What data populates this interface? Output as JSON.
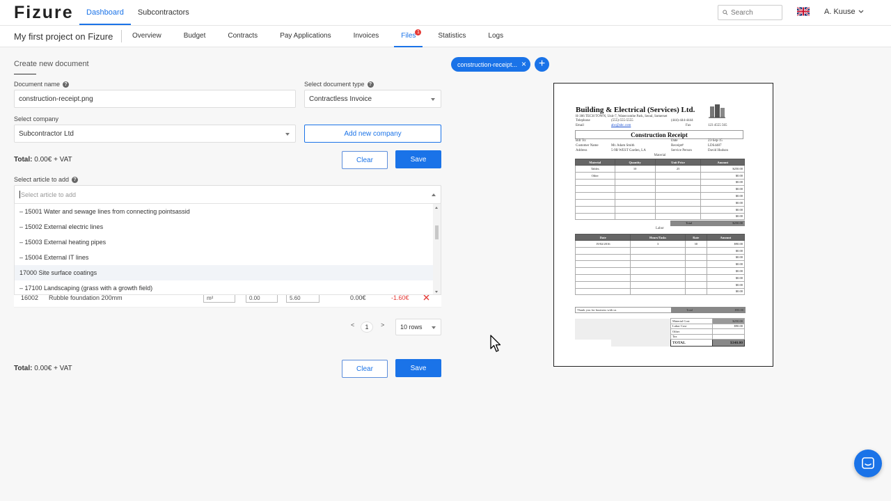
{
  "app": {
    "logo": "Fizure"
  },
  "topnav": {
    "items": [
      "Dashboard",
      "Subcontractors"
    ],
    "active": 0
  },
  "search": {
    "placeholder": "Search"
  },
  "user": {
    "name": "A. Kuuse"
  },
  "project": {
    "name": "My first project on Fizure",
    "tabs": [
      "Overview",
      "Budget",
      "Contracts",
      "Pay Applications",
      "Invoices",
      "Files",
      "Statistics",
      "Logs"
    ],
    "active_tab": 5,
    "files_badge": "1"
  },
  "form": {
    "title": "Create new document",
    "doc_name_label": "Document name",
    "doc_name_value": "construction-receipt.png",
    "doc_type_label": "Select document type",
    "doc_type_value": "Contractless Invoice",
    "company_label": "Select company",
    "company_value": "Subcontractor Ltd",
    "add_company_label": "Add new company",
    "total_label": "Total:",
    "total_value": "0.00€ + VAT",
    "clear_label": "Clear",
    "save_label": "Save",
    "article_label": "Select article to add",
    "article_placeholder": "Select article to add"
  },
  "dropdown": {
    "items": [
      "– 15001 Water and sewage lines from connecting pointsassid",
      "– 15002 External electric lines",
      "– 15003 External heating pipes",
      "– 15004 External IT lines",
      "17000 Site surface coatings",
      "– 17100 Landscaping (grass with a growth field)"
    ],
    "highlighted": 4
  },
  "article_row": {
    "code": "16002",
    "name": "Rubble foundation 200mm",
    "unit": "m²",
    "qty": "0.00",
    "price": "5.60",
    "sum": "0.00€",
    "diff": "-1.60€"
  },
  "pagination": {
    "prev": "<",
    "page": "1",
    "next": ">",
    "rows": "10 rows"
  },
  "file_chip": {
    "label": "construction-receipt..."
  },
  "colors": {
    "accent": "#1a73e8",
    "danger": "#e53935"
  },
  "receipt": {
    "company": "Building & Electrical (Services) Ltd.",
    "address_line": "H-306 TECH TOWN, Unit-7, Watercombe Park, Seoul, Somerset",
    "telephone_label": "Telephone",
    "telephone": "(555)-555-5555",
    "phone2": "(444)-444-4444",
    "email_label": "Email",
    "email": "abc@abc.com",
    "fax_label": "Fax",
    "fax": "123 4555 565",
    "title": "Construction Receipt",
    "bill_to_label": "Bill To:",
    "customer_label": "Customer Name",
    "customer": "Mr. Adam Smith",
    "address_label": "Address",
    "address": "5-9B WEST Garden, LA",
    "date_label": "Date",
    "date": "23-Sep-15",
    "receipt_label": "Receipt#",
    "receipt_no": "LDS4487",
    "service_label": "Service Person",
    "service_person": "David Hudson",
    "material_section": "Material",
    "material_headers": [
      "Material",
      "Quantity",
      "Unit Price",
      "Amount"
    ],
    "material_rows": [
      [
        "Tables",
        "10",
        "25",
        "$250.00"
      ],
      [
        "Other",
        "",
        "",
        "$0.00"
      ],
      [
        "",
        "",
        "",
        "$0.00"
      ],
      [
        "",
        "",
        "",
        "$0.00"
      ],
      [
        "",
        "",
        "",
        "$0.00"
      ],
      [
        "",
        "",
        "",
        "$0.00"
      ],
      [
        "",
        "",
        "",
        "$0.00"
      ],
      [
        "",
        "",
        "",
        "$0.00"
      ]
    ],
    "material_total_label": "Total",
    "material_total": "$250.00",
    "labor_section": "Labor",
    "labor_headers": [
      "Date",
      "Hours/Tasks",
      "Rate",
      "Amount"
    ],
    "labor_rows": [
      [
        "19/02/2016",
        "3",
        "30",
        "$90.00"
      ],
      [
        "",
        "",
        "",
        "$0.00"
      ],
      [
        "",
        "",
        "",
        "$0.00"
      ],
      [
        "",
        "",
        "",
        "$0.00"
      ],
      [
        "",
        "",
        "",
        "$0.00"
      ],
      [
        "",
        "",
        "",
        "$0.00"
      ],
      [
        "",
        "",
        "",
        "$0.00"
      ],
      [
        "",
        "",
        "",
        "$0.00"
      ]
    ],
    "labor_total_label": "Total",
    "labor_total": "$90.00",
    "thanks": "Thank you for business with us",
    "grand_label": "Total",
    "grand_total": "$90.00",
    "summary": [
      [
        "Material Cost",
        "$250.00"
      ],
      [
        "Labor Cost",
        "$90.00"
      ],
      [
        "Other",
        ""
      ],
      [
        "Tax",
        ""
      ]
    ],
    "final_label": "TOTAL",
    "final_total": "$340.00"
  }
}
